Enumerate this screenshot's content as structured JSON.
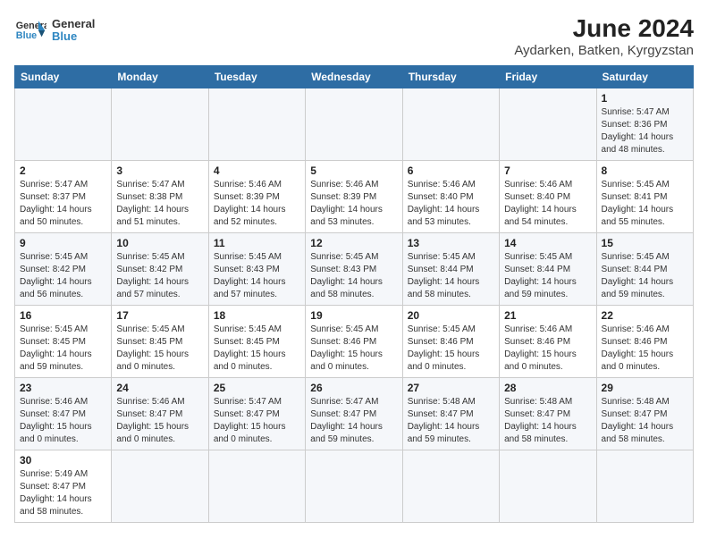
{
  "header": {
    "logo_line1": "General",
    "logo_line2": "Blue",
    "title": "June 2024",
    "subtitle": "Aydarken, Batken, Kyrgyzstan"
  },
  "weekdays": [
    "Sunday",
    "Monday",
    "Tuesday",
    "Wednesday",
    "Thursday",
    "Friday",
    "Saturday"
  ],
  "weeks": [
    [
      {
        "num": "",
        "info": ""
      },
      {
        "num": "",
        "info": ""
      },
      {
        "num": "",
        "info": ""
      },
      {
        "num": "",
        "info": ""
      },
      {
        "num": "",
        "info": ""
      },
      {
        "num": "",
        "info": ""
      },
      {
        "num": "1",
        "info": "Sunrise: 5:47 AM\nSunset: 8:36 PM\nDaylight: 14 hours\nand 48 minutes."
      }
    ],
    [
      {
        "num": "2",
        "info": "Sunrise: 5:47 AM\nSunset: 8:37 PM\nDaylight: 14 hours\nand 50 minutes."
      },
      {
        "num": "3",
        "info": "Sunrise: 5:47 AM\nSunset: 8:38 PM\nDaylight: 14 hours\nand 51 minutes."
      },
      {
        "num": "4",
        "info": "Sunrise: 5:46 AM\nSunset: 8:39 PM\nDaylight: 14 hours\nand 52 minutes."
      },
      {
        "num": "5",
        "info": "Sunrise: 5:46 AM\nSunset: 8:39 PM\nDaylight: 14 hours\nand 53 minutes."
      },
      {
        "num": "6",
        "info": "Sunrise: 5:46 AM\nSunset: 8:40 PM\nDaylight: 14 hours\nand 53 minutes."
      },
      {
        "num": "7",
        "info": "Sunrise: 5:46 AM\nSunset: 8:40 PM\nDaylight: 14 hours\nand 54 minutes."
      },
      {
        "num": "8",
        "info": "Sunrise: 5:45 AM\nSunset: 8:41 PM\nDaylight: 14 hours\nand 55 minutes."
      }
    ],
    [
      {
        "num": "9",
        "info": "Sunrise: 5:45 AM\nSunset: 8:42 PM\nDaylight: 14 hours\nand 56 minutes."
      },
      {
        "num": "10",
        "info": "Sunrise: 5:45 AM\nSunset: 8:42 PM\nDaylight: 14 hours\nand 57 minutes."
      },
      {
        "num": "11",
        "info": "Sunrise: 5:45 AM\nSunset: 8:43 PM\nDaylight: 14 hours\nand 57 minutes."
      },
      {
        "num": "12",
        "info": "Sunrise: 5:45 AM\nSunset: 8:43 PM\nDaylight: 14 hours\nand 58 minutes."
      },
      {
        "num": "13",
        "info": "Sunrise: 5:45 AM\nSunset: 8:44 PM\nDaylight: 14 hours\nand 58 minutes."
      },
      {
        "num": "14",
        "info": "Sunrise: 5:45 AM\nSunset: 8:44 PM\nDaylight: 14 hours\nand 59 minutes."
      },
      {
        "num": "15",
        "info": "Sunrise: 5:45 AM\nSunset: 8:44 PM\nDaylight: 14 hours\nand 59 minutes."
      }
    ],
    [
      {
        "num": "16",
        "info": "Sunrise: 5:45 AM\nSunset: 8:45 PM\nDaylight: 14 hours\nand 59 minutes."
      },
      {
        "num": "17",
        "info": "Sunrise: 5:45 AM\nSunset: 8:45 PM\nDaylight: 15 hours\nand 0 minutes."
      },
      {
        "num": "18",
        "info": "Sunrise: 5:45 AM\nSunset: 8:45 PM\nDaylight: 15 hours\nand 0 minutes."
      },
      {
        "num": "19",
        "info": "Sunrise: 5:45 AM\nSunset: 8:46 PM\nDaylight: 15 hours\nand 0 minutes."
      },
      {
        "num": "20",
        "info": "Sunrise: 5:45 AM\nSunset: 8:46 PM\nDaylight: 15 hours\nand 0 minutes."
      },
      {
        "num": "21",
        "info": "Sunrise: 5:46 AM\nSunset: 8:46 PM\nDaylight: 15 hours\nand 0 minutes."
      },
      {
        "num": "22",
        "info": "Sunrise: 5:46 AM\nSunset: 8:46 PM\nDaylight: 15 hours\nand 0 minutes."
      }
    ],
    [
      {
        "num": "23",
        "info": "Sunrise: 5:46 AM\nSunset: 8:47 PM\nDaylight: 15 hours\nand 0 minutes."
      },
      {
        "num": "24",
        "info": "Sunrise: 5:46 AM\nSunset: 8:47 PM\nDaylight: 15 hours\nand 0 minutes."
      },
      {
        "num": "25",
        "info": "Sunrise: 5:47 AM\nSunset: 8:47 PM\nDaylight: 15 hours\nand 0 minutes."
      },
      {
        "num": "26",
        "info": "Sunrise: 5:47 AM\nSunset: 8:47 PM\nDaylight: 14 hours\nand 59 minutes."
      },
      {
        "num": "27",
        "info": "Sunrise: 5:48 AM\nSunset: 8:47 PM\nDaylight: 14 hours\nand 59 minutes."
      },
      {
        "num": "28",
        "info": "Sunrise: 5:48 AM\nSunset: 8:47 PM\nDaylight: 14 hours\nand 58 minutes."
      },
      {
        "num": "29",
        "info": "Sunrise: 5:48 AM\nSunset: 8:47 PM\nDaylight: 14 hours\nand 58 minutes."
      }
    ],
    [
      {
        "num": "30",
        "info": "Sunrise: 5:49 AM\nSunset: 8:47 PM\nDaylight: 14 hours\nand 58 minutes."
      },
      {
        "num": "",
        "info": ""
      },
      {
        "num": "",
        "info": ""
      },
      {
        "num": "",
        "info": ""
      },
      {
        "num": "",
        "info": ""
      },
      {
        "num": "",
        "info": ""
      },
      {
        "num": "",
        "info": ""
      }
    ]
  ]
}
